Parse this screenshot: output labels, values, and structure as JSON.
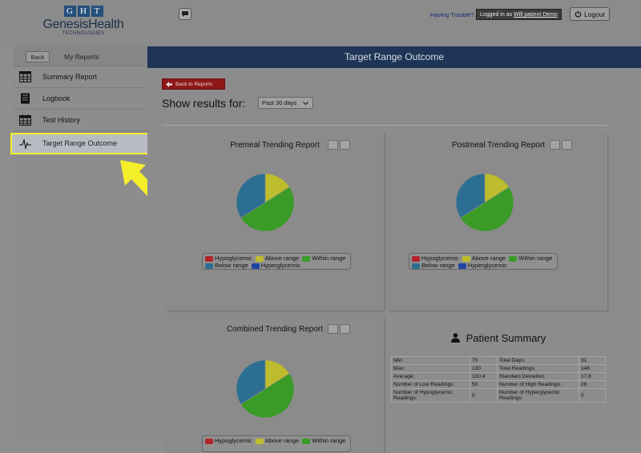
{
  "header": {
    "logo": {
      "letters": [
        "G",
        "H",
        "T"
      ],
      "name": "GenesisHealth",
      "tagline": "TECHNOLOGIES"
    },
    "trouble_link": "Having Trouble?",
    "logged_prefix": "Logged in as",
    "logged_user": "Will patient Demo",
    "logout_label": "Logout"
  },
  "sidebar": {
    "back_label": "Back",
    "title": "My Reports",
    "items": [
      {
        "label": "Summary Report",
        "icon": "summary-report-icon"
      },
      {
        "label": "Logbook",
        "icon": "logbook-icon"
      },
      {
        "label": "Test History",
        "icon": "calendar-icon"
      },
      {
        "label": "Target Range Outcome",
        "icon": "pulse-icon",
        "active": true
      }
    ]
  },
  "main": {
    "title": "Target Range Outcome",
    "back_reports_label": "Back to Reports",
    "show_results_label": "Show results for:",
    "range_select": "Past 30 days"
  },
  "legend_labels": {
    "hypoglycemic": "Hypoglycemic",
    "above": "Above range",
    "within": "Within range",
    "below": "Below range",
    "hyperglycemic": "Hyperglycemic"
  },
  "colors": {
    "hypoglycemic": "#b3242b",
    "above": "#bdbc2c",
    "within": "#3a9b27",
    "below": "#2d6f92",
    "hyperglycemic": "#1f44a3",
    "active_highlight": "#f4ef2a"
  },
  "chart_data": [
    {
      "type": "pie",
      "title": "Premeal Trending Report",
      "categories": [
        "Above range",
        "Within range",
        "Below range"
      ],
      "values": [
        16,
        50,
        34
      ]
    },
    {
      "type": "pie",
      "title": "Postmeal Trending Report",
      "categories": [
        "Above range",
        "Within range",
        "Below range"
      ],
      "values": [
        16,
        50,
        34
      ]
    },
    {
      "type": "pie",
      "title": "Combined Trending Report",
      "categories": [
        "Above range",
        "Within range",
        "Below range"
      ],
      "values": [
        16,
        50,
        34
      ]
    }
  ],
  "patient_summary": {
    "title": "Patient Summary",
    "rows": [
      [
        "Min:",
        "70",
        "Total Days:",
        "31"
      ],
      [
        "Max:",
        "130",
        "Total Readings:",
        "148"
      ],
      [
        "Average:",
        "100.4",
        "Standard Deviation:",
        "17.8"
      ],
      [
        "Number of Low Readings:",
        "50",
        "Number of High Readings:",
        "26"
      ],
      [
        "Number of Hypoglycemic Readings:",
        "0",
        "Number of Hyperglycemic Readings:",
        "0"
      ]
    ]
  }
}
